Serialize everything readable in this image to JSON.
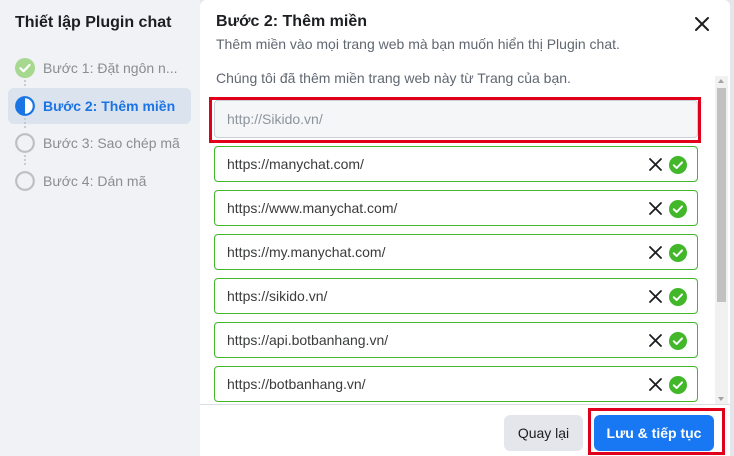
{
  "sidebar": {
    "title": "Thiết lập Plugin chat",
    "steps": [
      {
        "label": "Bước 1: Đặt ngôn n...",
        "state": "completed",
        "icon": "check-circle-icon"
      },
      {
        "label": "Bước 2: Thêm miền",
        "state": "current",
        "icon": "half-circle-icon"
      },
      {
        "label": "Bước 3: Sao chép mã",
        "state": "pending",
        "icon": "empty-circle-icon"
      },
      {
        "label": "Bước 4: Dán mã",
        "state": "pending",
        "icon": "empty-circle-icon"
      }
    ]
  },
  "panel": {
    "title": "Bước 2: Thêm miền",
    "subtitle": "Thêm miền vào mọi trang web mà bạn muốn hiển thị Plugin chat.",
    "intro": "Chúng tôi đã thêm miền trang web này từ Trang của bạn.",
    "new_domain_placeholder": "http://Sikido.vn/",
    "domains": [
      "https://manychat.com/",
      "https://www.manychat.com/",
      "https://my.manychat.com/",
      "https://sikido.vn/",
      "https://api.botbanhang.vn/",
      "https://botbanhang.vn/"
    ]
  },
  "footer": {
    "back_label": "Quay lại",
    "save_label": "Lưu & tiếp tục"
  },
  "colors": {
    "accent": "#1877f2",
    "success": "#42b72a",
    "highlight": "#e0001b"
  }
}
